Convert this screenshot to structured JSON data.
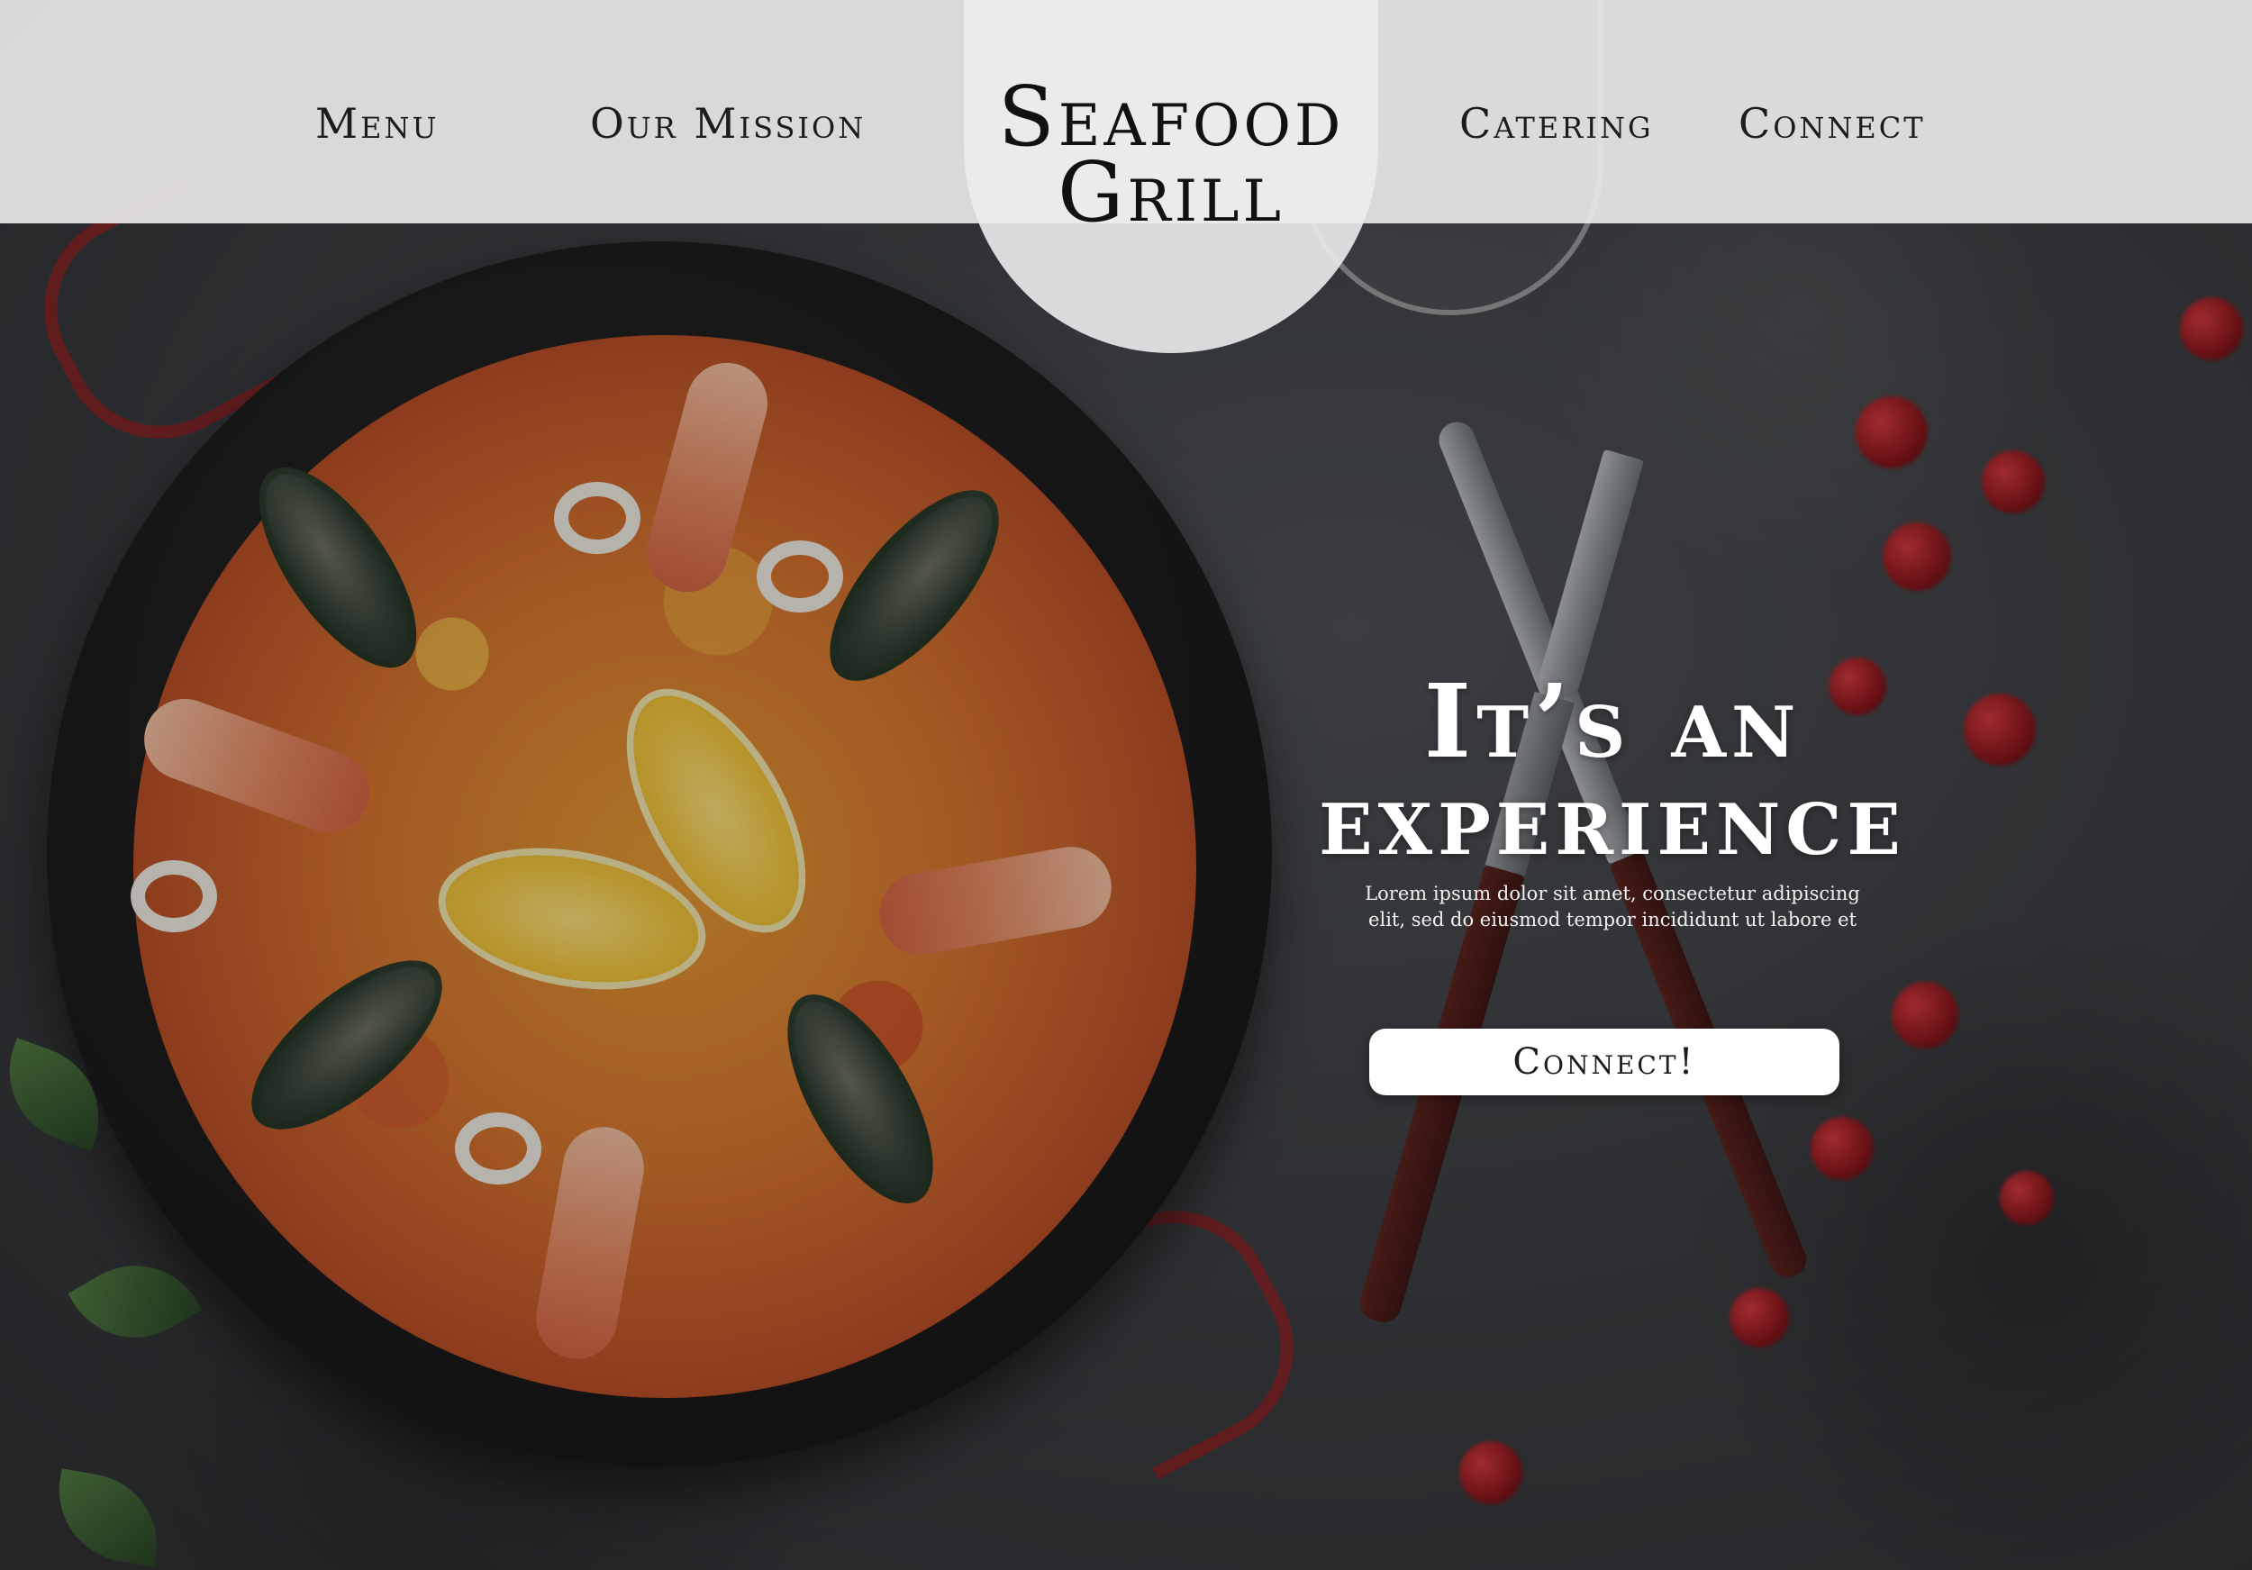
{
  "header": {
    "nav_left": [
      {
        "label": "Menu"
      },
      {
        "label": "Our Mission"
      }
    ],
    "nav_right": [
      {
        "label": "Catering"
      },
      {
        "label": "Connect"
      }
    ],
    "logo": {
      "line1": "Seafood",
      "line2": "Grill"
    }
  },
  "hero": {
    "title_line1": "It’s an",
    "title_line2": "experience",
    "body": "Lorem ipsum dolor sit amet, consectetur adipiscing elit, sed do eiusmod tempor incididunt ut labore et",
    "cta_label": "Connect!"
  },
  "colors": {
    "header_background": "#ececee",
    "text_dark": "#1c1c1c",
    "hero_text": "#ffffff",
    "cta_background": "#ffffff"
  }
}
